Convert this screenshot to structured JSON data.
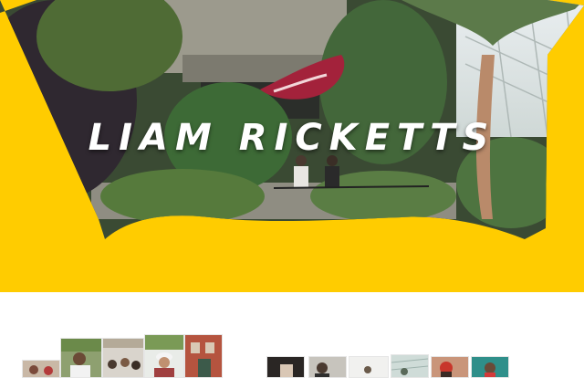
{
  "hero": {
    "title": "LIAM RICKETTS",
    "accent_color": "#ffcc00"
  },
  "gallery_left": {
    "items": [
      {
        "icon": "photo-group-people"
      },
      {
        "icon": "photo-man-portrait"
      },
      {
        "icon": "photo-crowd"
      },
      {
        "icon": "photo-person-hat"
      },
      {
        "icon": "photo-building-red"
      }
    ]
  },
  "gallery_right": {
    "items": [
      {
        "icon": "photo-dark-room"
      },
      {
        "icon": "photo-portrait"
      },
      {
        "icon": "photo-light-room"
      },
      {
        "icon": "photo-glass-house"
      },
      {
        "icon": "photo-person-red-hat"
      },
      {
        "icon": "photo-teal-portrait"
      }
    ]
  }
}
